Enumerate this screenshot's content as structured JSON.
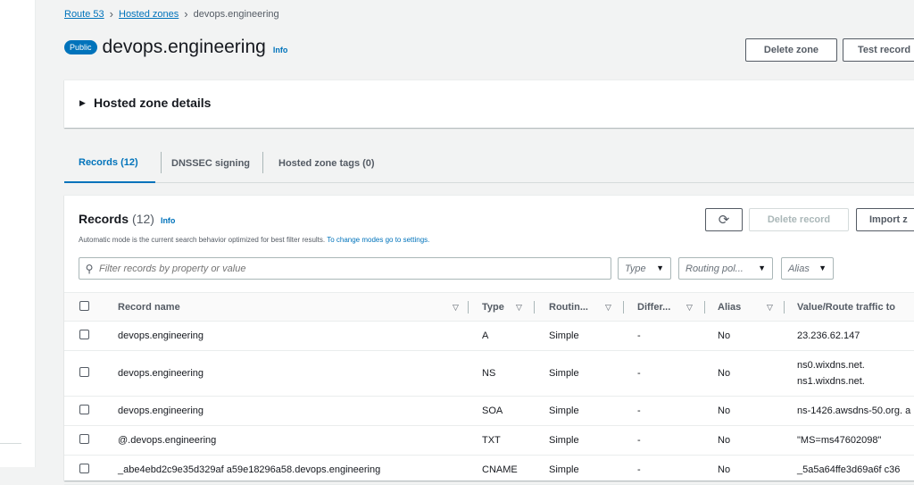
{
  "breadcrumb": {
    "root": "Route 53",
    "parent": "Hosted zones",
    "current": "devops.engineering"
  },
  "header": {
    "badge": "Public",
    "title": "devops.engineering",
    "info": "Info",
    "delete_zone": "Delete zone",
    "test_record": "Test record"
  },
  "details_panel": {
    "label": "Hosted zone details"
  },
  "tabs": [
    {
      "label": "Records (12)"
    },
    {
      "label": "DNSSEC signing"
    },
    {
      "label": "Hosted zone tags (0)"
    }
  ],
  "records": {
    "title": "Records",
    "count": "(12)",
    "info": "Info",
    "subtitle": "Automatic mode is the current search behavior optimized for best filter results.",
    "subtitle_link": "To change modes go to settings.",
    "search_placeholder": "Filter records by property or value",
    "filters": {
      "type": "Type",
      "routing": "Routing pol...",
      "alias": "Alias"
    },
    "delete_record": "Delete record",
    "import": "Import z"
  },
  "table": {
    "columns": [
      "Record name",
      "Type",
      "Routin...",
      "Differ...",
      "Alias",
      "Value/Route traffic to"
    ],
    "rows": [
      {
        "name": "devops.engineering",
        "type": "A",
        "routing": "Simple",
        "differ": "-",
        "alias": "No",
        "value": "23.236.62.147",
        "value2": ""
      },
      {
        "name": "devops.engineering",
        "type": "NS",
        "routing": "Simple",
        "differ": "-",
        "alias": "No",
        "value": "ns0.wixdns.net.",
        "value2": "ns1.wixdns.net."
      },
      {
        "name": "devops.engineering",
        "type": "SOA",
        "routing": "Simple",
        "differ": "-",
        "alias": "No",
        "value": "ns-1426.awsdns-50.org. a",
        "value2": ""
      },
      {
        "name": "@.devops.engineering",
        "type": "TXT",
        "routing": "Simple",
        "differ": "-",
        "alias": "No",
        "value": "\"MS=ms47602098\"",
        "value2": ""
      },
      {
        "name": "_abe4ebd2c9e35d329af a59e18296a58.devops.engineering",
        "type": "CNAME",
        "routing": "Simple",
        "differ": "-",
        "alias": "No",
        "value": "_5a5a64ffe3d69a6f c36",
        "value2": ""
      }
    ]
  }
}
